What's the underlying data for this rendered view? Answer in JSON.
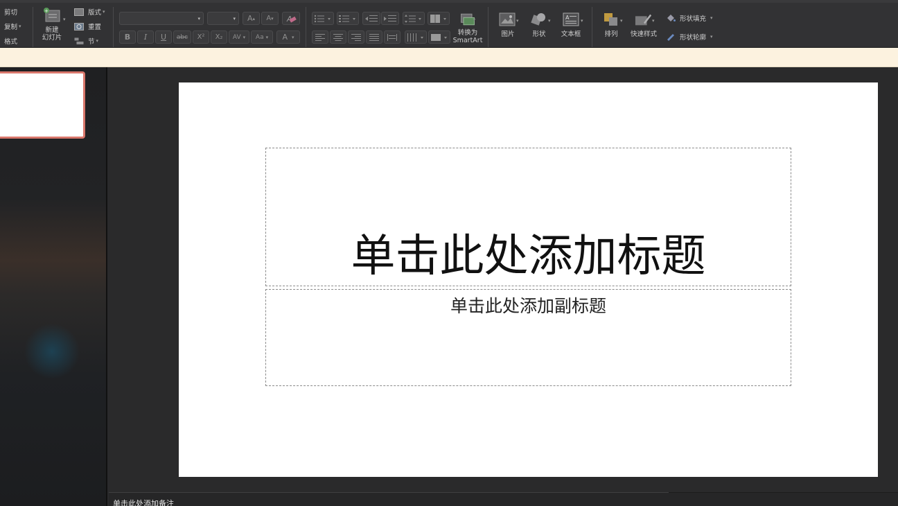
{
  "clipboard": {
    "cut": "剪切",
    "copy": "复制",
    "format": "格式"
  },
  "slides_group": {
    "new_slide_line1": "新建",
    "new_slide_line2": "幻灯片",
    "layout": "版式",
    "reset": "重置",
    "section": "节"
  },
  "font": {
    "family": "",
    "size": "",
    "bold": "B",
    "italic": "I",
    "underline": "U",
    "strike": "abc",
    "superscript": "X²",
    "subscript": "X₂",
    "spacing": "AV",
    "case": "Aa",
    "color": "A",
    "grow": "A",
    "shrink": "A"
  },
  "paragraph": {
    "smartart_line1": "转换为",
    "smartart_line2": "SmartArt"
  },
  "insert": {
    "picture": "图片",
    "shape": "形状",
    "textbox": "文本框"
  },
  "arrange": {
    "arrange": "排列",
    "quick_styles": "快速样式",
    "shape_fill": "形状填充",
    "shape_outline": "形状轮廓"
  },
  "slide": {
    "title_placeholder": "单击此处添加标题",
    "subtitle_placeholder": "单击此处添加副标题"
  },
  "notes": {
    "placeholder": "单击此处添加备注"
  },
  "colors": {
    "ribbon": "#323234",
    "notice_bar": "#fcf2df",
    "thumb_border": "#d9776c"
  }
}
